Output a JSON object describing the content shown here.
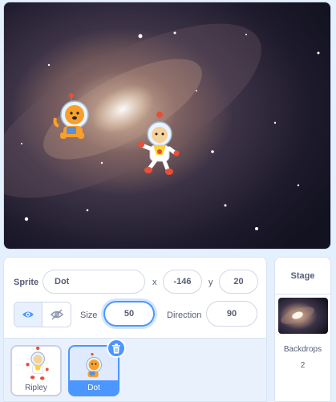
{
  "sprite_info": {
    "sprite_label": "Sprite",
    "sprite_name": "Dot",
    "x_label": "x",
    "x_value": "-146",
    "y_label": "y",
    "y_value": "20",
    "show_label": "Show",
    "size_label": "Size",
    "size_value": "50",
    "direction_label": "Direction",
    "direction_value": "90"
  },
  "sprites": [
    {
      "name": "Ripley",
      "selected": false
    },
    {
      "name": "Dot",
      "selected": true
    }
  ],
  "stage_panel": {
    "title": "Stage",
    "backdrops_label": "Backdrops",
    "backdrops_count": "2"
  },
  "colors": {
    "accent": "#4c97ff",
    "panel_bg": "#e5f0ff",
    "text": "#575e75"
  },
  "icons": [
    "eye-icon",
    "eye-slash-icon",
    "trash-icon"
  ]
}
